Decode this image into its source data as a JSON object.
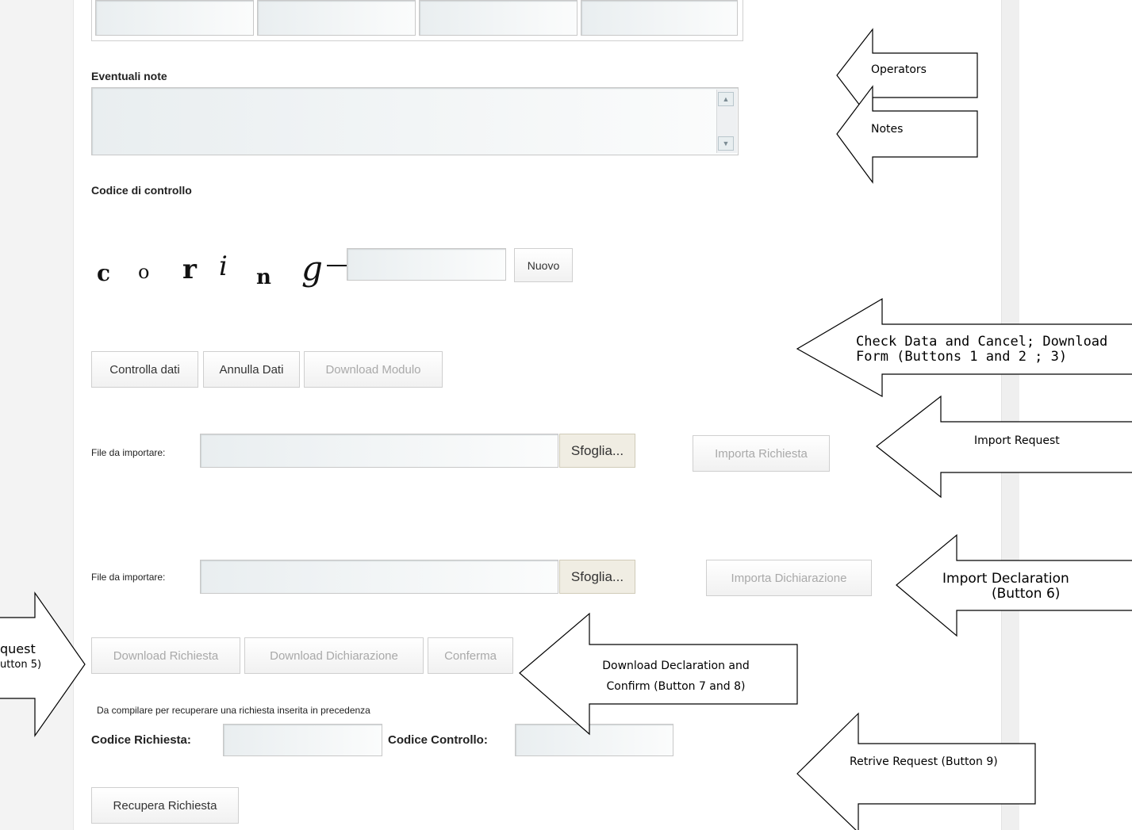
{
  "form": {
    "notes_label": "Eventuali note",
    "captcha_label": "Codice di controllo",
    "captcha_chars": [
      "c",
      "o",
      "r",
      "i",
      "n",
      "g"
    ],
    "new_captcha_button": "Nuovo",
    "check_data_button": "Controlla dati",
    "cancel_data_button": "Annulla Dati",
    "download_form_button": "Download Modulo",
    "import_request": {
      "file_label": "File da importare:",
      "browse_button": "Sfoglia...",
      "import_button": "Importa Richiesta"
    },
    "import_declaration": {
      "file_label": "File da importare:",
      "browse_button": "Sfoglia...",
      "import_button": "Importa Dichiarazione"
    },
    "download_request_button": "Download Richiesta",
    "download_declaration_button": "Download Dichiarazione",
    "confirm_button": "Conferma",
    "retrieve_hint": "Da compilare per recuperare una richiesta inserita in precedenza",
    "request_code_label": "Codice Richiesta:",
    "control_code_label": "Codice Controllo:",
    "retrieve_button": "Recupera Richiesta"
  },
  "callouts": {
    "operators": "Operators",
    "notes": "Notes",
    "check_cancel_line1": "Check Data and Cancel; Download",
    "check_cancel_line2": "Form (Buttons 1 and 2 ; 3)",
    "import_request": "Import Request",
    "import_declaration_line1": "Import Declaration",
    "import_declaration_line2": "(Button 6)",
    "download_request_line1": "quest",
    "download_request_line2": "utton 5)",
    "download_declaration_line1": "Download Declaration and",
    "download_declaration_line2": "Confirm (Button 7 and 8)",
    "retrieve_request": "Retrive Request  (Button 9)"
  }
}
